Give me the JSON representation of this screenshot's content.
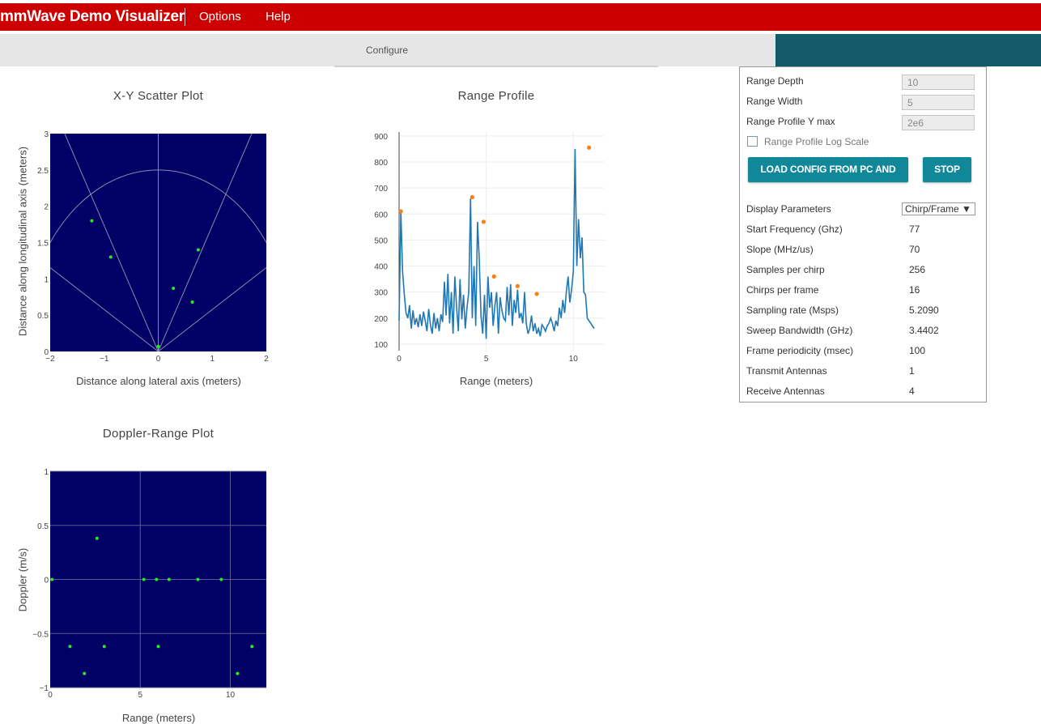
{
  "app": {
    "title": "mmWave Demo Visualizer",
    "menus": [
      "Options",
      "Help"
    ]
  },
  "tabs": {
    "configure": "Configure"
  },
  "panel": {
    "range_depth": {
      "label": "Range Depth",
      "value": "10"
    },
    "range_width": {
      "label": "Range Width",
      "value": "5"
    },
    "range_profile_ymax": {
      "label": "Range Profile Y max",
      "value": "2e6"
    },
    "log_scale_label": "Range Profile Log Scale",
    "load_button": "LOAD CONFIG FROM PC AND SEND",
    "stop_button": "STOP",
    "display_params_label": "Display Parameters",
    "display_params_value": "Chirp/Frame ▼",
    "params": [
      {
        "label": "Start Frequency (Ghz)",
        "value": "77"
      },
      {
        "label": "Slope (MHz/us)",
        "value": "70"
      },
      {
        "label": "Samples per chirp",
        "value": "256"
      },
      {
        "label": "Chirps per frame",
        "value": "16"
      },
      {
        "label": "Sampling rate (Msps)",
        "value": "5.2090"
      },
      {
        "label": "Sweep Bandwidth (GHz)",
        "value": "3.4402"
      },
      {
        "label": "Frame periodicity (msec)",
        "value": "100"
      },
      {
        "label": "Transmit Antennas",
        "value": "1"
      },
      {
        "label": "Receive Antennas",
        "value": "4"
      }
    ]
  },
  "colors": {
    "brand_red": "#cc0000",
    "teal": "#145a6b",
    "button_teal": "#118899",
    "plot_bg": "#000066",
    "point_green": "#22ee22",
    "line_blue": "#1f77b4",
    "peak_orange": "#ff7f0e"
  },
  "chart_data": [
    {
      "type": "scatter",
      "title": "X-Y Scatter Plot",
      "xlabel": "Distance along lateral axis (meters)",
      "ylabel": "Distance along longitudinal axis (meters)",
      "xlim": [
        -2,
        2
      ],
      "ylim": [
        0,
        3
      ],
      "xticks": [
        -2,
        -1,
        0,
        1,
        2
      ],
      "xtick_labels": [
        "−2",
        "−1",
        "0",
        "1",
        "2"
      ],
      "yticks": [
        0,
        0.5,
        1,
        1.5,
        2,
        2.5,
        3
      ],
      "ytick_labels": [
        "0",
        "0.5",
        "1",
        "1.5",
        "2",
        "2.5",
        "3"
      ],
      "grid_arc_radius": 2.5,
      "grid_ray_angles_deg": [
        60,
        -60,
        30,
        -30
      ],
      "points": [
        {
          "x": -1.23,
          "y": 1.8
        },
        {
          "x": -0.88,
          "y": 1.3
        },
        {
          "x": 0.0,
          "y": 0.07
        },
        {
          "x": 0.28,
          "y": 0.87
        },
        {
          "x": 0.63,
          "y": 0.68
        },
        {
          "x": 0.74,
          "y": 1.4
        }
      ]
    },
    {
      "type": "line",
      "title": "Range Profile",
      "xlabel": "Range (meters)",
      "ylabel": "",
      "xlim": [
        0,
        11.8
      ],
      "ylim": [
        75,
        915
      ],
      "xticks": [
        0,
        5,
        10
      ],
      "xtick_labels": [
        "0",
        "5",
        "10"
      ],
      "yticks": [
        100,
        200,
        300,
        400,
        500,
        600,
        700,
        800,
        900
      ],
      "ytick_labels": [
        "100",
        "200",
        "300",
        "400",
        "500",
        "600",
        "700",
        "800",
        "900"
      ],
      "x": [
        0,
        0.1,
        0.2,
        0.3,
        0.4,
        0.5,
        0.6,
        0.7,
        0.8,
        0.9,
        1.0,
        1.1,
        1.2,
        1.3,
        1.4,
        1.5,
        1.6,
        1.7,
        1.8,
        1.9,
        2.0,
        2.1,
        2.2,
        2.3,
        2.4,
        2.5,
        2.6,
        2.7,
        2.8,
        2.9,
        3.0,
        3.1,
        3.2,
        3.3,
        3.4,
        3.5,
        3.6,
        3.7,
        3.8,
        3.9,
        4.0,
        4.1,
        4.2,
        4.3,
        4.4,
        4.5,
        4.6,
        4.7,
        4.8,
        4.9,
        5.0,
        5.1,
        5.2,
        5.3,
        5.4,
        5.5,
        5.6,
        5.7,
        5.8,
        5.9,
        6.0,
        6.1,
        6.2,
        6.3,
        6.4,
        6.5,
        6.6,
        6.7,
        6.8,
        6.9,
        7.0,
        7.1,
        7.2,
        7.3,
        7.4,
        7.5,
        7.6,
        7.7,
        7.8,
        7.9,
        8.0,
        8.1,
        8.2,
        8.3,
        8.4,
        8.5,
        8.6,
        8.7,
        8.8,
        8.9,
        9.0,
        9.1,
        9.2,
        9.3,
        9.4,
        9.5,
        9.6,
        9.7,
        9.8,
        9.9,
        10.0,
        10.1,
        10.2,
        10.3,
        10.4,
        10.5,
        10.6,
        10.7,
        10.8,
        10.9,
        11.0,
        11.1,
        11.2
      ],
      "y": [
        190,
        610,
        380,
        290,
        220,
        200,
        250,
        160,
        230,
        175,
        200,
        165,
        215,
        170,
        225,
        190,
        150,
        235,
        175,
        140,
        220,
        160,
        200,
        150,
        215,
        185,
        340,
        210,
        370,
        180,
        300,
        140,
        360,
        245,
        150,
        350,
        195,
        290,
        160,
        240,
        300,
        660,
        200,
        400,
        170,
        570,
        430,
        210,
        140,
        290,
        120,
        360,
        240,
        300,
        170,
        250,
        300,
        140,
        280,
        230,
        200,
        190,
        320,
        210,
        330,
        170,
        270,
        220,
        310,
        200,
        220,
        180,
        300,
        180,
        140,
        160,
        210,
        150,
        180,
        140,
        160,
        130,
        175,
        165,
        150,
        170,
        180,
        200,
        180,
        150,
        190,
        170,
        240,
        200,
        270,
        220,
        300,
        360,
        260,
        310,
        380,
        850,
        400,
        580,
        430,
        510,
        300,
        290,
        200,
        190,
        180,
        170,
        160
      ],
      "peaks": [
        {
          "x": 0.1,
          "y": 610
        },
        {
          "x": 4.2,
          "y": 665
        },
        {
          "x": 4.85,
          "y": 570
        },
        {
          "x": 5.45,
          "y": 360
        },
        {
          "x": 6.8,
          "y": 323
        },
        {
          "x": 7.9,
          "y": 293
        },
        {
          "x": 10.9,
          "y": 855
        }
      ]
    },
    {
      "type": "scatter",
      "title": "Doppler-Range Plot",
      "xlabel": "Range (meters)",
      "ylabel": "Doppler (m/s)",
      "xlim": [
        0,
        12
      ],
      "ylim": [
        -1,
        1
      ],
      "xticks": [
        0,
        5,
        10
      ],
      "xtick_labels": [
        "0",
        "5",
        "10"
      ],
      "yticks": [
        -1,
        -0.5,
        0,
        0.5,
        1
      ],
      "ytick_labels": [
        "−1",
        "−0.5",
        "0",
        "0.5",
        "1"
      ],
      "points": [
        {
          "x": 0.1,
          "y": 0
        },
        {
          "x": 2.6,
          "y": 0.38
        },
        {
          "x": 5.2,
          "y": 0
        },
        {
          "x": 5.9,
          "y": 0
        },
        {
          "x": 6.6,
          "y": 0
        },
        {
          "x": 8.2,
          "y": 0
        },
        {
          "x": 9.5,
          "y": 0
        },
        {
          "x": 1.1,
          "y": -0.62
        },
        {
          "x": 3.0,
          "y": -0.62
        },
        {
          "x": 6.0,
          "y": -0.62
        },
        {
          "x": 11.2,
          "y": -0.62
        },
        {
          "x": 1.9,
          "y": -0.87
        },
        {
          "x": 10.4,
          "y": -0.87
        }
      ]
    }
  ]
}
